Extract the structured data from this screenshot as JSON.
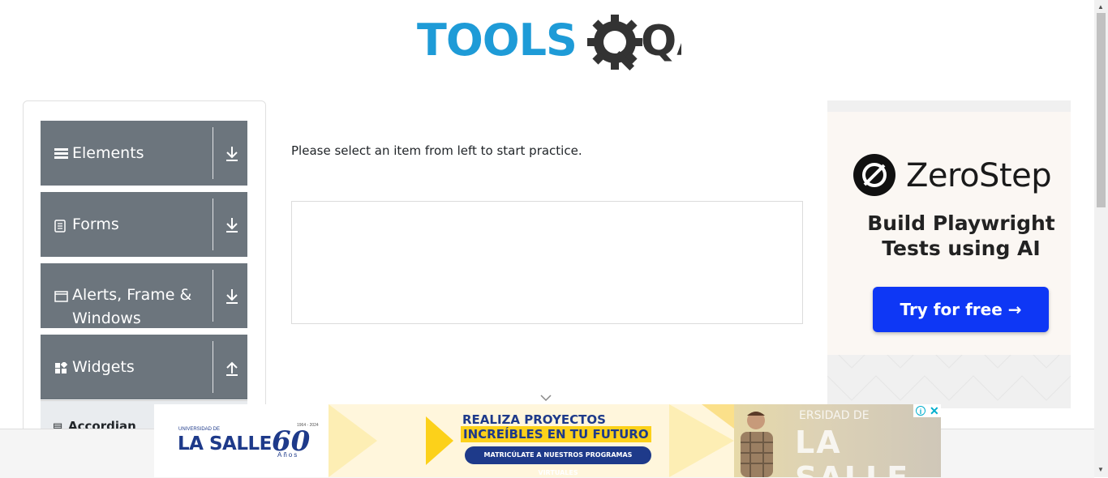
{
  "header": {
    "logo_text_left": "TOOLS",
    "logo_text_right": "QA",
    "colors": {
      "tools": "#1e9bd7",
      "qa": "#333333"
    }
  },
  "sidebar": {
    "groups": [
      {
        "label": "Elements",
        "icon": "hamburger-icon",
        "arrow": "download-arrow-icon"
      },
      {
        "label": "Forms",
        "icon": "document-icon",
        "arrow": "download-arrow-icon"
      },
      {
        "label_line1": "Alerts, Frame &",
        "label_line2": "Windows",
        "icon": "window-icon",
        "arrow": "download-arrow-icon"
      },
      {
        "label": "Widgets",
        "icon": "grid-icon",
        "arrow": "upload-arrow-icon"
      }
    ],
    "sub_items": [
      {
        "label": "Accordian",
        "icon": "document-icon"
      }
    ],
    "colors": {
      "group_bg": "#6c757d"
    }
  },
  "main": {
    "instruction": "Please select an item from left to start practice."
  },
  "ad_right": {
    "brand": "ZeroStep",
    "tagline_line1": "Build Playwright",
    "tagline_line2": "Tests using AI",
    "button": "Try for free →",
    "colors": {
      "button": "#0e37f5"
    }
  },
  "ad_bottom": {
    "university_small": "UNIVERSIDAD DE",
    "university_name": "LA SALLE",
    "anniversary": "60",
    "anos": "Años",
    "years": "1964 - 2024",
    "headline1": "REALIZA PROYECTOS",
    "headline2": "INCREÍBLES EN TU FUTURO",
    "cta": "MATRICÚLATE A NUESTROS PROGRAMAS VIRTUALES",
    "photo_top": "ERSIDAD DE",
    "photo_text": "LA SALLE",
    "info": "i",
    "close": "✕",
    "colors": {
      "navy": "#1e3a8a",
      "yellow": "#fcd11a"
    }
  }
}
